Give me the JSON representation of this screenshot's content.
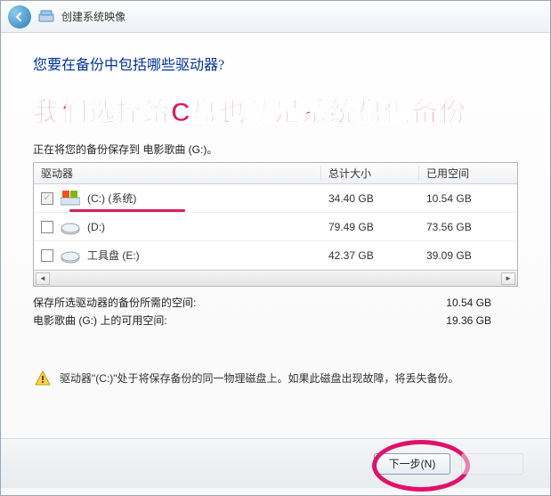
{
  "titlebar": {
    "title": "创建系统映像"
  },
  "content": {
    "question": "您要在备份中包括哪些驱动器?",
    "annotation": "我们选择给C盘也就是系统盘做备份",
    "save_to": "正在将您的备份保存到 电影歌曲 (G:)。"
  },
  "table": {
    "headers": {
      "drive": "驱动器",
      "total": "总计大小",
      "used": "已用空间"
    },
    "rows": [
      {
        "checked": true,
        "disabled": true,
        "icon": "win",
        "label": "(C:) (系统)",
        "total": "34.40 GB",
        "used": "10.54 GB"
      },
      {
        "checked": false,
        "disabled": false,
        "icon": "hdd",
        "label": "(D:)",
        "total": "79.49 GB",
        "used": "73.56 GB"
      },
      {
        "checked": false,
        "disabled": false,
        "icon": "hdd",
        "label": "工具盘 (E:)",
        "total": "42.37 GB",
        "used": "39.09 GB"
      }
    ]
  },
  "summary": {
    "required_label": "保存所选驱动器的备份所需的空间:",
    "required_value": "10.54 GB",
    "available_label": "电影歌曲 (G:) 上的可用空间:",
    "available_value": "19.36 GB"
  },
  "warning": {
    "text": "驱动器\"(C:)\"处于将保存备份的同一物理磁盘上。如果此磁盘出现故障，将丢失备份。"
  },
  "buttons": {
    "next": "下一步(N)"
  }
}
